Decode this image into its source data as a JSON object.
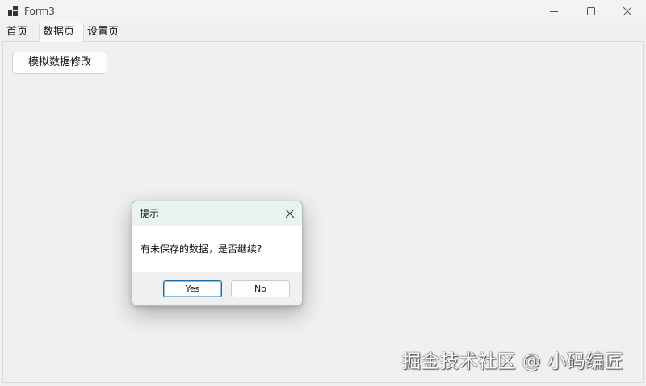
{
  "window": {
    "title": "Form3",
    "app_icon": "app-icon",
    "controls": {
      "minimize_icon": "minimize-icon",
      "maximize_icon": "maximize-icon",
      "close_icon": "close-icon"
    }
  },
  "tabs": [
    {
      "label": "首页",
      "selected": false
    },
    {
      "label": "数据页",
      "selected": true
    },
    {
      "label": "设置页",
      "selected": false
    }
  ],
  "data_page": {
    "modify_button_label": "模拟数据修改"
  },
  "dialog": {
    "title": "提示",
    "message": "有未保存的数据，是否继续?",
    "close_icon": "close-icon",
    "yes_label": "Yes",
    "no_label": "No",
    "titlebar_color": "#eaf4ef",
    "default_button_border": "#1c6ea4"
  },
  "watermark": {
    "text": "掘金技术社区 @ 小码编匠"
  }
}
